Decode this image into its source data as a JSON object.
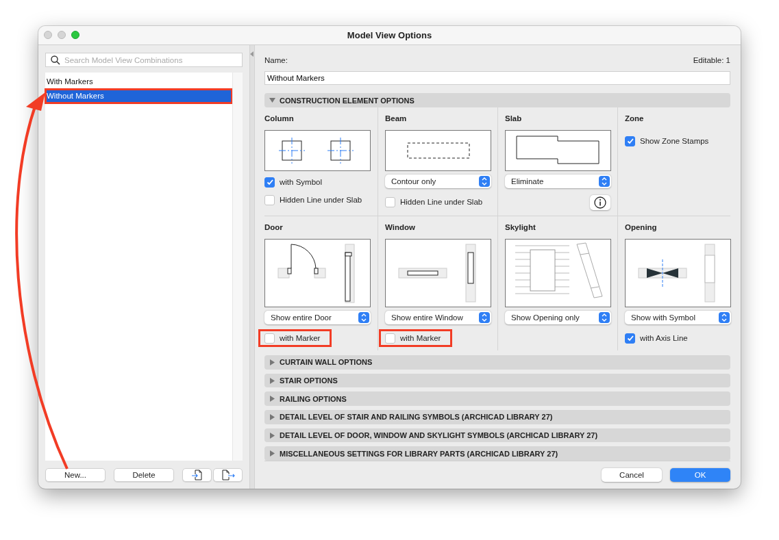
{
  "window": {
    "title": "Model View Options"
  },
  "sidebar": {
    "search": {
      "placeholder": "Search Model View Combinations"
    },
    "items": [
      {
        "label": "With Markers",
        "selected": false,
        "highlighted": false
      },
      {
        "label": "Without Markers",
        "selected": true,
        "highlighted": true
      }
    ],
    "buttons": [
      {
        "kind": "text",
        "label": "New..."
      },
      {
        "kind": "text",
        "label": "Delete"
      },
      {
        "kind": "import"
      },
      {
        "kind": "export"
      }
    ]
  },
  "name_field": {
    "label": "Name:",
    "value": "Without Markers",
    "editable": "Editable: 1"
  },
  "sections": [
    {
      "title": "CONSTRUCTION ELEMENT OPTIONS",
      "expanded": true,
      "cells": [
        {
          "title": "Column",
          "kind": "column",
          "checks": [
            {
              "label": "with Symbol",
              "checked": true,
              "highlighted": false
            },
            {
              "label": "Hidden Line under Slab",
              "checked": false,
              "highlighted": false
            }
          ]
        },
        {
          "title": "Beam",
          "kind": "beam",
          "select": "Contour only",
          "checks": [
            {
              "label": "Hidden Line under Slab",
              "checked": false,
              "highlighted": false
            }
          ]
        },
        {
          "title": "Slab",
          "kind": "slab",
          "select": "Eliminate",
          "info_button": true
        },
        {
          "title": "Zone",
          "kind": "options",
          "checks": [
            {
              "label": "Show Zone Stamps",
              "checked": true,
              "highlighted": false
            }
          ]
        },
        {
          "title": "Door",
          "kind": "door",
          "select": "Show entire Door",
          "checks": [
            {
              "label": "with Marker",
              "checked": false,
              "highlighted": true
            }
          ]
        },
        {
          "title": "Window",
          "kind": "window",
          "select": "Show entire Window",
          "checks": [
            {
              "label": "with Marker",
              "checked": false,
              "highlighted": true
            }
          ]
        },
        {
          "title": "Skylight",
          "kind": "skylight",
          "select": "Show Opening only"
        },
        {
          "title": "Opening",
          "kind": "opening",
          "select": "Show with Symbol",
          "checks": [
            {
              "label": "with Axis Line",
              "checked": true,
              "highlighted": false
            }
          ]
        }
      ]
    },
    {
      "title": "CURTAIN WALL OPTIONS",
      "expanded": false
    },
    {
      "title": "STAIR OPTIONS",
      "expanded": false
    },
    {
      "title": "RAILING OPTIONS",
      "expanded": false
    },
    {
      "title": "DETAIL LEVEL OF STAIR AND RAILING SYMBOLS (ARCHICAD LIBRARY 27)",
      "expanded": false
    },
    {
      "title": "DETAIL LEVEL OF DOOR, WINDOW AND SKYLIGHT SYMBOLS (ARCHICAD LIBRARY 27)",
      "expanded": false
    },
    {
      "title": "MISCELLANEOUS SETTINGS FOR LIBRARY PARTS (ARCHICAD LIBRARY 27)",
      "expanded": false
    }
  ],
  "buttons": [
    {
      "label": "Cancel",
      "kind": "secondary"
    },
    {
      "label": "OK",
      "kind": "primary"
    }
  ]
}
